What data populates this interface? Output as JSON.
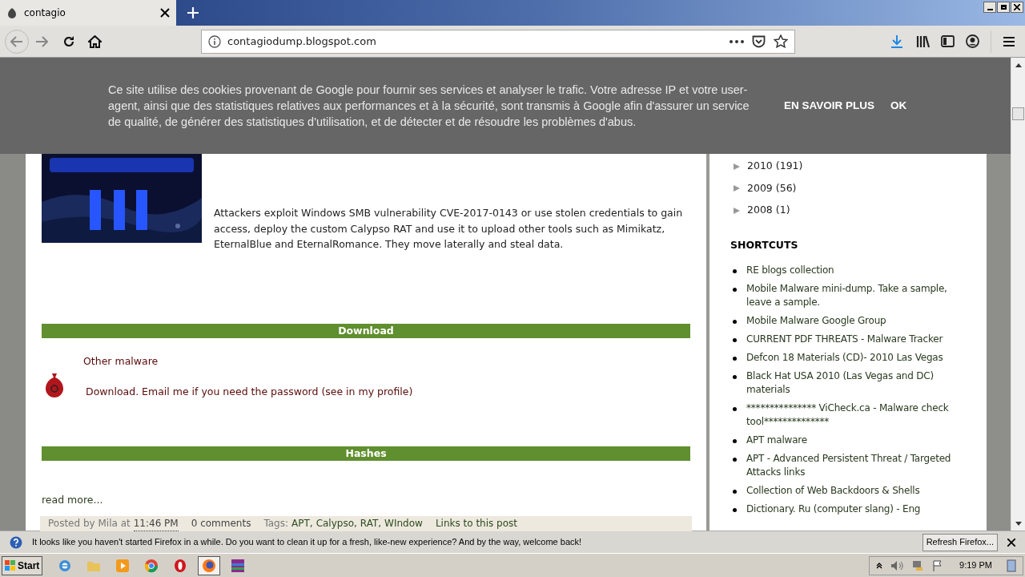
{
  "browser": {
    "tab_title": "contagio",
    "url": "contagiodump.blogspot.com"
  },
  "cookie_banner": {
    "text": "Ce site utilise des cookies provenant de Google pour fournir ses services et analyser le trafic. Votre adresse IP et votre user-agent, ainsi que des statistiques relatives aux performances et à la sécurité, sont transmis à Google afin d'assurer un service de qualité, de générer des statistiques d'utilisation, et de détecter et de résoudre les problèmes d'abus.",
    "buttons": [
      "EN SAVOIR PLUS",
      "OK"
    ]
  },
  "post": {
    "paragraph": "Attackers exploit Windows SMB vulnerability CVE-2017-0143 or use stolen credentials to gain access, deploy the custom Calypso RAT and use it to upload other tools such as Mimikatz, EternalBlue and EternalRomance. They move laterally and steal data.",
    "download_heading": "Download",
    "download_title": "Other malware",
    "download_text": "Download. Email me if you need the password (see in my profile)",
    "hashes_heading": "Hashes",
    "read_more": "read more...",
    "footer": {
      "posted_by": "Posted by Mila at",
      "time": "11:46 PM",
      "comments": "0 comments",
      "tags_label": "Tags:",
      "tags": [
        "APT,",
        "Calypso,",
        "RAT,",
        "WIndow"
      ],
      "links": "Links to this post"
    }
  },
  "sidebar": {
    "archive": [
      {
        "year": "2010",
        "count": "(191)"
      },
      {
        "year": "2009",
        "count": "(56)"
      },
      {
        "year": "2008",
        "count": "(1)"
      }
    ],
    "shortcuts_title": "SHORTCUTS",
    "shortcuts": [
      "RE blogs collection",
      "Mobile Malware mini-dump. Take a sample, leave a sample.",
      "Mobile Malware Google Group",
      "CURRENT PDF THREATS - Malware Tracker",
      "Defcon 18 Materials (CD)- 2010 Las Vegas",
      "Black Hat USA 2010 (Las Vegas and DC) materials",
      "*************** ViCheck.ca - Malware check tool**************",
      "APT malware",
      "APT - Advanced Persistent Threat / Targeted Attacks links",
      "Collection of Web Backdoors & Shells",
      "Dictionary. Ru (computer slang) - Eng"
    ]
  },
  "notification": {
    "text": "It looks like you haven't started Firefox in a while. Do you want to clean it up for a fresh, like-new experience? And by the way, welcome back!",
    "button": "Refresh Firefox..."
  },
  "taskbar": {
    "start": "Start",
    "apps": [
      {
        "kind": "ie",
        "selected": false
      },
      {
        "kind": "folder",
        "selected": false
      },
      {
        "kind": "media",
        "selected": false
      },
      {
        "kind": "chrome",
        "selected": false
      },
      {
        "kind": "opera",
        "selected": false
      },
      {
        "kind": "firefox",
        "selected": true
      },
      {
        "kind": "archive",
        "selected": false
      }
    ],
    "clock": "9:19 PM"
  }
}
